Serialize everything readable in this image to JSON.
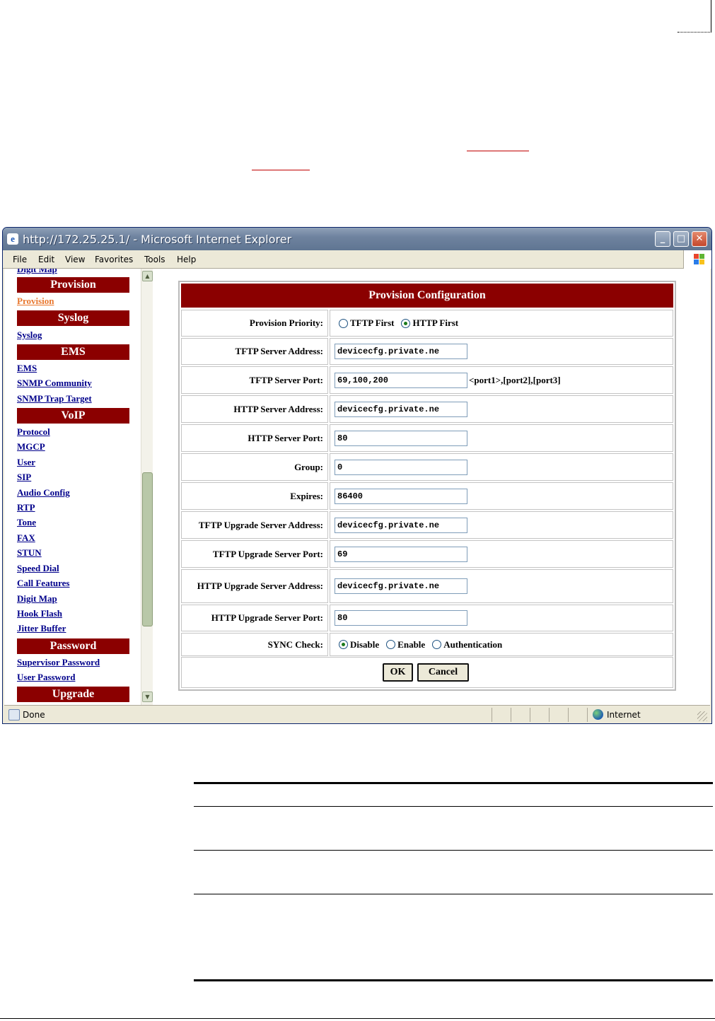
{
  "window": {
    "title": "http://172.25.25.1/ - Microsoft Internet Explorer",
    "icon_name": "ie-icon",
    "buttons": {
      "minimize": "_",
      "maximize": "□",
      "close": "✕"
    }
  },
  "menubar": {
    "items": [
      "File",
      "Edit",
      "View",
      "Favorites",
      "Tools",
      "Help"
    ]
  },
  "nav": {
    "cut_item": "Digit Map",
    "sections": [
      {
        "header": "Provision",
        "links": [
          "Provision"
        ]
      },
      {
        "header": "Syslog",
        "links": [
          "Syslog"
        ]
      },
      {
        "header": "EMS",
        "links": [
          "EMS",
          "SNMP Community",
          "SNMP Trap Target"
        ]
      },
      {
        "header": "VoIP",
        "links": [
          "Protocol",
          "MGCP",
          "User",
          "SIP",
          "Audio Config",
          "RTP",
          "Tone",
          "FAX",
          "STUN",
          "Speed Dial",
          "Call Features",
          "Digit Map",
          "Hook Flash",
          "Jitter Buffer"
        ]
      },
      {
        "header": "Password",
        "links": [
          "Supervisor Password",
          "User Password"
        ]
      },
      {
        "header": "Upgrade",
        "links": []
      }
    ],
    "active_link": "Provision",
    "colors": {
      "header_bg": "#8b0000",
      "link": "#00008b",
      "active_link": "#e8762d"
    }
  },
  "config": {
    "title": "Provision Configuration",
    "priority": {
      "label": "Provision Priority:",
      "options": [
        "TFTP First",
        "HTTP First"
      ],
      "selected": "HTTP First"
    },
    "tftp_server_address": {
      "label": "TFTP Server Address:",
      "value": "devicecfg.private.ne"
    },
    "tftp_server_port": {
      "label": "TFTP Server Port:",
      "value": "69,100,200",
      "hint": "<port1>,[port2],[port3]"
    },
    "http_server_address": {
      "label": "HTTP Server Address:",
      "value": "devicecfg.private.ne"
    },
    "http_server_port": {
      "label": "HTTP Server Port:",
      "value": "80"
    },
    "group": {
      "label": "Group:",
      "value": "0"
    },
    "expires": {
      "label": "Expires:",
      "value": "86400"
    },
    "tftp_upgrade_server_address": {
      "label": "TFTP Upgrade Server Address:",
      "value": "devicecfg.private.ne"
    },
    "tftp_upgrade_server_port": {
      "label": "TFTP Upgrade Server Port:",
      "value": "69"
    },
    "http_upgrade_server_address": {
      "label": "HTTP Upgrade Server Address:",
      "value": "devicecfg.private.ne"
    },
    "http_upgrade_server_port": {
      "label": "HTTP Upgrade Server Port:",
      "value": "80"
    },
    "sync_check": {
      "label": "SYNC Check:",
      "options": [
        "Disable",
        "Enable",
        "Authentication"
      ],
      "selected": "Disable"
    },
    "ok_label": "OK",
    "cancel_label": "Cancel",
    "colors": {
      "title_bg": "#8b0000"
    }
  },
  "statusbar": {
    "status": "Done",
    "zone": "Internet"
  }
}
